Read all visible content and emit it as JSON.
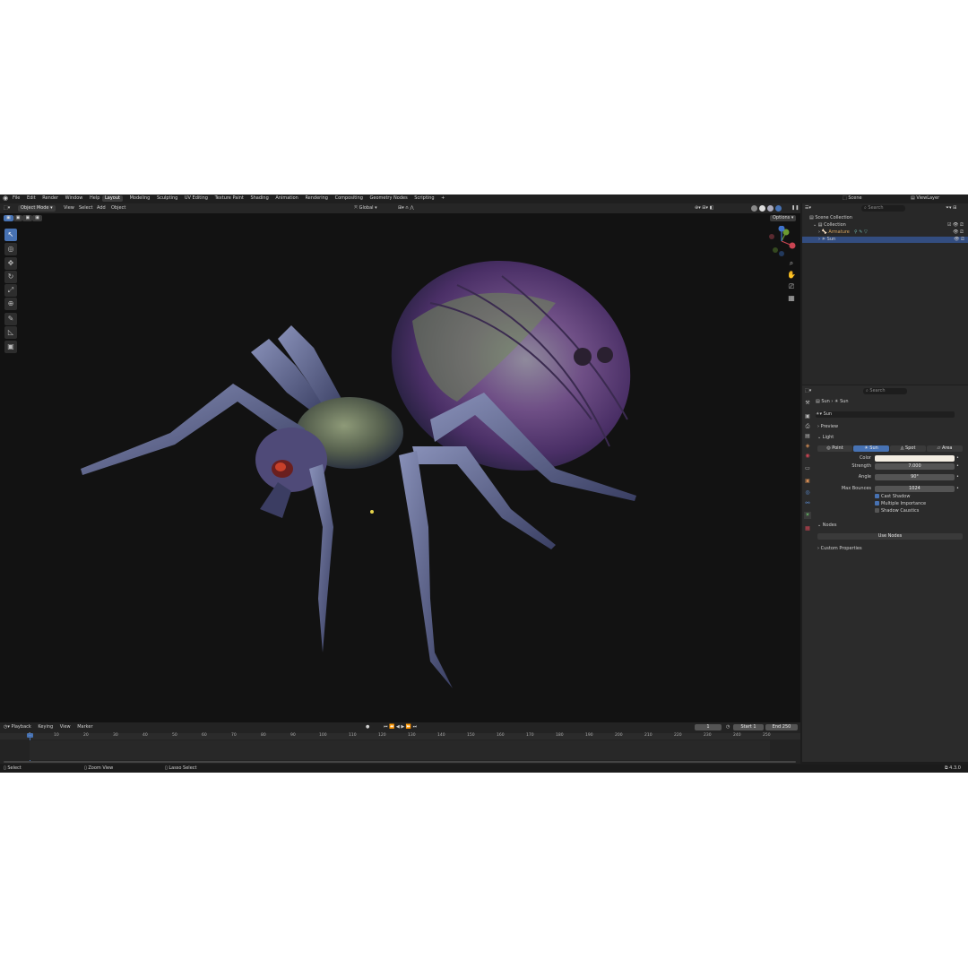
{
  "menu": [
    "File",
    "Edit",
    "Render",
    "Window",
    "Help"
  ],
  "workspaces": [
    "Layout",
    "Modeling",
    "Sculpting",
    "UV Editing",
    "Texture Paint",
    "Shading",
    "Animation",
    "Rendering",
    "Compositing",
    "Geometry Nodes",
    "Scripting"
  ],
  "workspace_add": "+",
  "scene": {
    "label": "Scene",
    "viewlayer": "ViewLayer"
  },
  "viewport_header": {
    "mode": "Object Mode",
    "items": [
      "View",
      "Select",
      "Add",
      "Object"
    ],
    "transform": "Global",
    "options": "Options"
  },
  "outliner": {
    "search_placeholder": "Search",
    "items": [
      "Scene Collection",
      "Collection",
      "Armature",
      "Sun"
    ]
  },
  "properties": {
    "search_placeholder": "Search",
    "breadcrumb": [
      "Sun",
      "Sun"
    ],
    "datablock": "Sun",
    "panels": {
      "preview": "Preview",
      "light": "Light",
      "nodes": "Nodes",
      "custom": "Custom Properties"
    },
    "light_types": [
      "Point",
      "Sun",
      "Spot",
      "Area"
    ],
    "color_label": "Color",
    "color_value": "#f3ede2",
    "strength_label": "Strength",
    "strength_value": "7.000",
    "angle_label": "Angle",
    "angle_value": "90°",
    "bounces_label": "Max Bounces",
    "bounces_value": "1024",
    "cast_shadow": "Cast Shadow",
    "multiple_importance": "Multiple Importance",
    "shadow_caustics": "Shadow Caustics",
    "use_nodes": "Use Nodes"
  },
  "timeline": {
    "menus": [
      "Playback",
      "Keying",
      "View",
      "Marker"
    ],
    "current_frame": "1",
    "start_label": "Start",
    "start_value": "1",
    "end_label": "End",
    "end_value": "250",
    "ticks": [
      "1",
      "10",
      "20",
      "30",
      "40",
      "50",
      "60",
      "70",
      "80",
      "90",
      "100",
      "110",
      "120",
      "130",
      "140",
      "150",
      "160",
      "170",
      "180",
      "190",
      "200",
      "210",
      "220",
      "230",
      "240",
      "250"
    ]
  },
  "status": {
    "select": "Select",
    "zoom": "Zoom View",
    "lasso": "Lasso Select",
    "version": "4.3.0"
  },
  "colors": {
    "accent": "#4772b3",
    "selected_row": "#334d80"
  }
}
